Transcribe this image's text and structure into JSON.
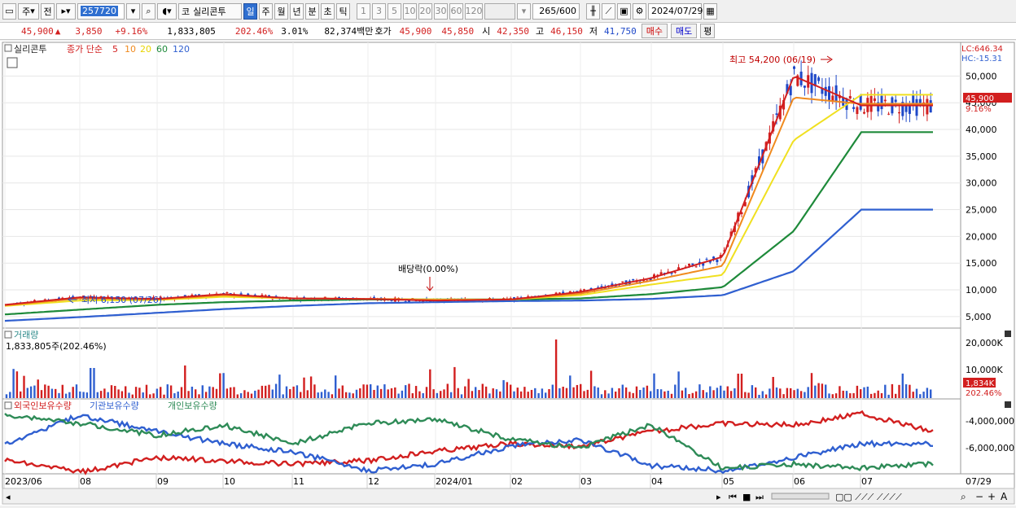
{
  "toolbar": {
    "type_selector": "주",
    "prev_label": "전",
    "code_value": "257720",
    "code_prefix": "코",
    "stock_name": "실리콘투",
    "period_tabs": [
      "일",
      "주",
      "월",
      "년",
      "분",
      "초",
      "틱"
    ],
    "minute_options": [
      "1",
      "3",
      "5",
      "10",
      "20",
      "30",
      "60",
      "120"
    ],
    "count": "265",
    "count_total": "/600",
    "date": "2024/07/29"
  },
  "quote": {
    "price": "45,900",
    "change": "3,850",
    "change_pct": "+9.16%",
    "volume": "1,833,805",
    "volume_ratio": "202.46%",
    "turnover_pct": "3.01%",
    "amount": "82,374백만",
    "bid_ask_label": "호가",
    "bid_ask": "45,900",
    "ask2": "45,850",
    "open_label": "시",
    "open": "42,350",
    "high_label": "고",
    "high": "46,150",
    "low_label": "저",
    "low": "41,750",
    "buy_label": "매수",
    "sell_label": "매도",
    "eval_label": "평"
  },
  "price_panel": {
    "legend_name": "실리콘투",
    "legend_ma": "종가 단순",
    "ma_periods": [
      "5",
      "10",
      "20",
      "60",
      "120"
    ],
    "ma_colors": [
      "#d21f1f",
      "#f08a1e",
      "#f0e020",
      "#1e8a3a",
      "#2f5fd0"
    ],
    "lc_label": "LC:646.34",
    "hc_label": "HC:-15.31",
    "y_ticks": [
      "50,000",
      "45,000",
      "40,000",
      "35,000",
      "30,000",
      "25,000",
      "20,000",
      "15,000",
      "10,000",
      "5,000"
    ],
    "y_values": [
      50000,
      45000,
      40000,
      35000,
      30000,
      25000,
      20000,
      15000,
      10000,
      5000
    ],
    "current_price": "45,900",
    "current_pct": "9.16%",
    "high_annotation": "최고 54,200 (06/19)",
    "low_annotation": "최저 6,150 (07/26)",
    "dividend_annotation": "배당락(0.00%)"
  },
  "volume_panel": {
    "title": "거래량",
    "value_label": "1,833,805주(202.46%)",
    "y_ticks": [
      "20,000K",
      "10,000K"
    ],
    "current_value": "1,834K",
    "current_pct": "202.46%"
  },
  "holdings_panel": {
    "series": [
      "외국인보유수량",
      "기관보유수량",
      "개인보유수량"
    ],
    "series_colors": [
      "#d21f1f",
      "#2f5fd0",
      "#2e8b57"
    ],
    "y_ticks": [
      "-4,000,000",
      "-6,000,000"
    ]
  },
  "x_axis": {
    "labels": [
      "2023/06",
      "08",
      "09",
      "10",
      "11",
      "12",
      "2024/01",
      "02",
      "03",
      "04",
      "05",
      "06",
      "07"
    ],
    "current": "07/29"
  },
  "chart_data": {
    "type": "line",
    "title": "",
    "x": [
      "2023/06",
      "2023/08",
      "2023/09",
      "2023/10",
      "2023/11",
      "2023/12",
      "2024/01",
      "2024/02",
      "2024/03",
      "2024/04",
      "2024/05",
      "2024/06",
      "2024/07"
    ],
    "series": [
      {
        "name": "5",
        "values": [
          7200,
          8600,
          8300,
          9200,
          8400,
          8300,
          8000,
          8200,
          9600,
          12200,
          16200,
          50000,
          44500
        ]
      },
      {
        "name": "10",
        "values": [
          7100,
          8400,
          8200,
          9000,
          8400,
          8300,
          8100,
          8200,
          9300,
          11700,
          14500,
          46000,
          44800
        ]
      },
      {
        "name": "20",
        "values": [
          7000,
          8000,
          8100,
          8700,
          8400,
          8300,
          8200,
          8200,
          9000,
          11000,
          12800,
          38000,
          46500
        ]
      },
      {
        "name": "60",
        "values": [
          5400,
          6300,
          7200,
          7700,
          8000,
          8200,
          8200,
          8200,
          8400,
          9200,
          10500,
          21000,
          39500
        ]
      },
      {
        "name": "120",
        "values": [
          4200,
          4900,
          5700,
          6400,
          7000,
          7500,
          7700,
          7900,
          8000,
          8300,
          9000,
          13500,
          25000
        ]
      }
    ],
    "ylim": [
      3000,
      56000
    ],
    "annotations": [
      "최고 54,200 (06/19)",
      "최저 6,150 (07/26)",
      "배당락(0.00%)"
    ]
  }
}
